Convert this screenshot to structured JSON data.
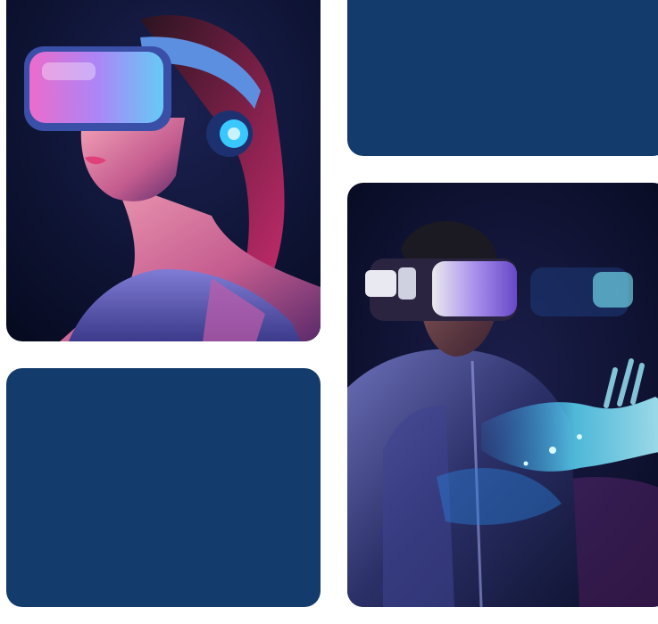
{
  "gallery": {
    "tiles": [
      {
        "kind": "photo",
        "icon": "woman-vr-headset-photo"
      },
      {
        "kind": "solid",
        "color": "#133b6b"
      },
      {
        "kind": "photo",
        "icon": "man-vr-headset-hologram-photo"
      },
      {
        "kind": "solid",
        "color": "#133b6b"
      }
    ]
  },
  "colors": {
    "tile_blue": "#133b6b",
    "photo_background": "#0a0f2a",
    "neon_pink": "#ff3fa6",
    "neon_cyan": "#38c8ff",
    "neon_violet": "#9d7bff"
  }
}
